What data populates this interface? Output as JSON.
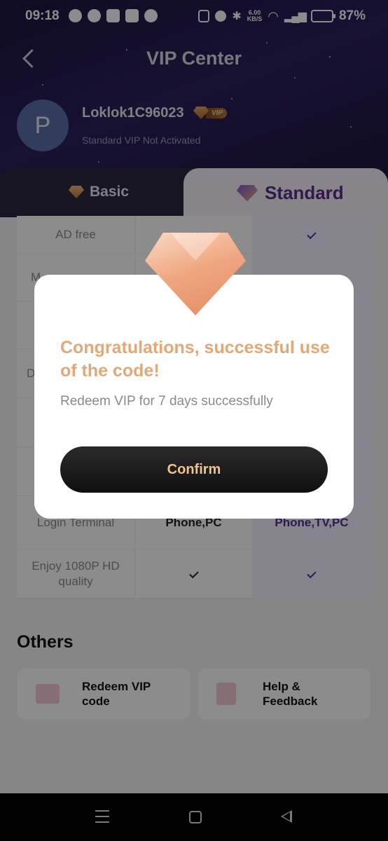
{
  "status_bar": {
    "time": "09:18",
    "speed_value": "6.00",
    "speed_unit": "KB/S",
    "battery_percent": "87%",
    "battery_level": 0.87
  },
  "header": {
    "title": "VIP Center"
  },
  "profile": {
    "avatar_initial": "P",
    "username": "Loklok1C96023",
    "vip_badge": "VIP",
    "vip_status": "Standard VIP Not Activated"
  },
  "tabs": [
    {
      "label": "Basic",
      "selected": false
    },
    {
      "label": "Standard",
      "selected": true
    }
  ],
  "comparison": [
    {
      "feature": "AD free",
      "basic": "check",
      "standard": "check"
    },
    {
      "feature": "M",
      "basic": "",
      "standard": ""
    },
    {
      "feature": "",
      "basic": "",
      "standard": ""
    },
    {
      "feature": "D",
      "basic": "",
      "standard": ""
    },
    {
      "feature": "",
      "basic": "",
      "standard": ""
    },
    {
      "feature": "",
      "basic": "",
      "standard": ""
    },
    {
      "feature": "Login Terminal",
      "basic": "Phone,PC",
      "standard": "Phone,TV,PC"
    },
    {
      "feature": "Enjoy 1080P HD quality",
      "basic": "check",
      "standard": "check"
    }
  ],
  "others": {
    "title": "Others",
    "redeem_label": "Redeem VIP code",
    "help_label": "Help & Feedback"
  },
  "modal": {
    "title": "Congratulations, successful use of the code!",
    "message": "Redeem VIP for 7 days successfully",
    "confirm_label": "Confirm"
  },
  "colors": {
    "accent_gold": "#e0a977",
    "accent_purple": "#5a2f8f",
    "header_bg": "#231a4b"
  }
}
